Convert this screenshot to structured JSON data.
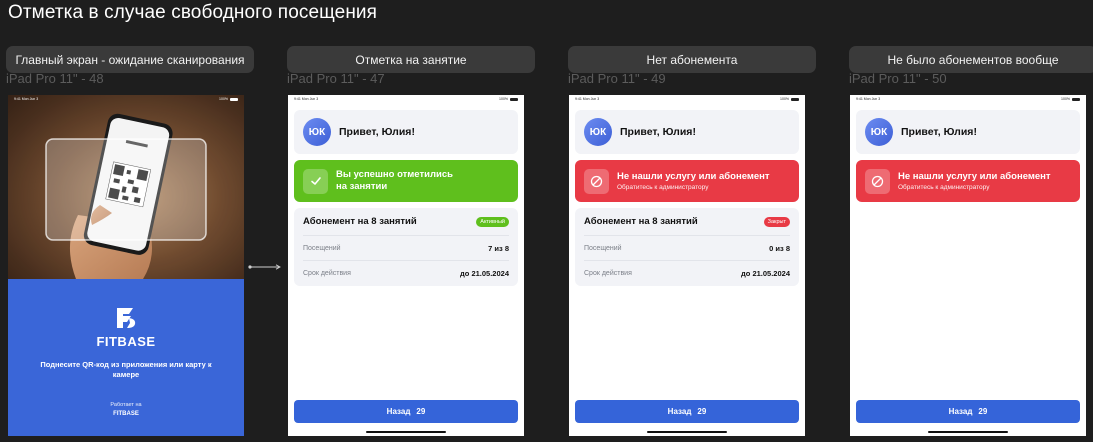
{
  "page_title": "Отметка в случае свободного посещения",
  "frames": [
    {
      "tag": "Главный экран - ожидание сканирования",
      "name": "iPad Pro 11\" - 48"
    },
    {
      "tag": "Отметка на занятие",
      "name": "iPad Pro 11\" - 47"
    },
    {
      "tag": "Нет абонемента",
      "name": "iPad Pro 11\" - 49"
    },
    {
      "tag": "Не было абонементов вообще",
      "name": "iPad Pro 11\" - 50"
    }
  ],
  "statusbar": {
    "time": "9:41",
    "date": "Mon Jun 3",
    "battery": "100%"
  },
  "main_screen": {
    "brand": "FITBASE",
    "hint": "Поднесите QR-код из приложения или карту к камере",
    "powered_by": "Работает на",
    "powered_brand": "FITBASE"
  },
  "greeting": {
    "initials": "ЮК",
    "text": "Привет, Юлия!"
  },
  "success": {
    "title": "Вы успешно отметились на занятии"
  },
  "error": {
    "title": "Не нашли услугу или абонемент",
    "subtitle": "Обратитесь к администратору"
  },
  "subscription": {
    "title": "Абонемент на 8 занятий",
    "visits_label": "Посещений",
    "validity_label": "Срок действия",
    "valid_until": "до 21.05.2024",
    "active": {
      "badge": "Активный",
      "visits": "7 из 8"
    },
    "closed": {
      "badge": "Закрыт",
      "visits": "0 из 8"
    }
  },
  "back_button": {
    "label": "Назад",
    "countdown": "29"
  },
  "colors": {
    "primary": "#3564d9",
    "success": "#5fbf1d",
    "error": "#e83a45",
    "card": "#f2f3f7"
  }
}
